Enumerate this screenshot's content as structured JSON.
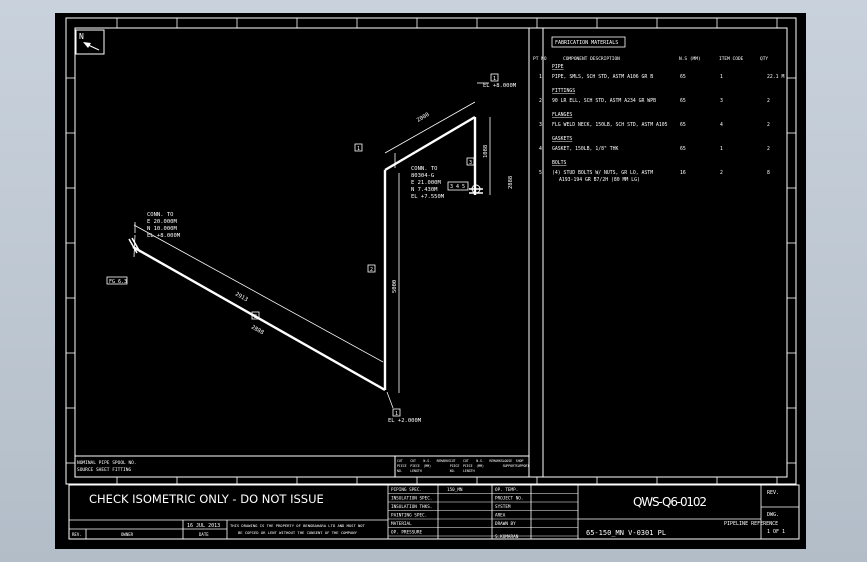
{
  "drawing": {
    "north_label": "N",
    "notice": "CHECK ISOMETRIC ONLY - DO NOT ISSUE",
    "drawing_number": "QWS-Q6-0102",
    "line_ref": "65-150_MN    V-0301    PL",
    "pipeline_ref_label": "PIPELINE REFERENCE",
    "rev_label": "REV.",
    "dwg_label": "DWG.",
    "sheet": "1 OF 1",
    "date": "16 JUL 2013",
    "rev_col": "REV.",
    "owner_col": "OWNER",
    "date_col": "DATE",
    "legal": [
      "THIS DRAWING IS THE PROPERTY OF BENGBAHARA LTD AND MUST NOT",
      "BE COPIED OR LENT WITHOUT THE CONSENT OF THE COMPANY"
    ],
    "spec_labels": [
      "PIPING SPEC.",
      "INSULATION SPEC.",
      "INSULATION THKS.",
      "PAINTING SPEC.",
      "MATERIAL",
      "OP. PRESSURE"
    ],
    "spec_values": [
      "150_MN",
      "",
      "",
      "",
      "",
      ""
    ],
    "info_labels": [
      "OP. TEMP.",
      "PROJECT NO.",
      "SYSTEM",
      "AREA",
      "DRAWN BY",
      ""
    ],
    "info_values": [
      "",
      "",
      "",
      "",
      "",
      ""
    ],
    "drawn_by": "S.KUMARAN"
  },
  "table": {
    "title": "FABRICATION MATERIALS",
    "col_pt": "PT NO",
    "col_desc": "COMPONENT DESCRIPTION",
    "col_ns": "N.S (MM)",
    "col_item": "ITEM CODE",
    "col_qty": "QTY",
    "rows": [
      {
        "type": "section",
        "text": "PIPE"
      },
      {
        "type": "item",
        "pt": "1",
        "desc": "PIPE, SMLS, SCH STD, ASTM A106 GR B",
        "ns": "65",
        "item": "1",
        "qty": "22.1 M"
      },
      {
        "type": "section",
        "text": "FITTINGS"
      },
      {
        "type": "item",
        "pt": "2",
        "desc": "90 LR ELL, SCH STD, ASTM A234 GR WPB",
        "ns": "65",
        "item": "3",
        "qty": "2"
      },
      {
        "type": "section",
        "text": "FLANGES"
      },
      {
        "type": "item",
        "pt": "3",
        "desc": "FLG WELD NECK, 150LB, SCH STD, ASTM A105",
        "ns": "65",
        "item": "4",
        "qty": "2"
      },
      {
        "type": "section",
        "text": "GASKETS"
      },
      {
        "type": "item",
        "pt": "4",
        "desc": "GASKET, 150LB, 1/8\" THK",
        "ns": "65",
        "item": "1",
        "qty": "2"
      },
      {
        "type": "section",
        "text": "BOLTS"
      },
      {
        "type": "item",
        "pt": "5",
        "desc": "(4) STUD BOLTS W/ NUTS, GR LO, ASTM",
        "ns": "16",
        "item": "2",
        "qty": "8"
      },
      {
        "type": "cont",
        "desc": "A193-194 GR B7/2H (80 MM LG)"
      }
    ],
    "bottom_headers": [
      "CUT PIECE NO.",
      "CUT PIECE LENGTH",
      "N.S. (MM)",
      "REMARKS",
      "CUT PIECE NO.",
      "CUT PIECE LENGTH",
      "N.S. (MM)",
      "REMARKS",
      "LOOSE SUPPORT",
      "SHOP SUPPORT"
    ],
    "notes": [
      "NOMINAL PIPE SPOOL NO.",
      "SOURCE SHEET FITTING"
    ]
  },
  "iso": {
    "comp1": [
      "CONN. TO",
      "E 20.000M",
      "N 10.000M",
      "EL +8.000M"
    ],
    "comp2": [
      "CONN. TO",
      "80304-G",
      "E 21.000M",
      "N 7.430M",
      "EL +7.550M"
    ],
    "tag_left": "FG 6.3",
    "tag_right": "3 4 5",
    "el_top": "EL +8.000M",
    "el_bottom": "EL +2.000M",
    "dims": [
      "2913",
      "2888",
      "5000",
      "2000",
      "1088",
      "2888"
    ],
    "pt_marks": [
      "1",
      "2",
      "2",
      "3",
      "1",
      "1"
    ]
  }
}
